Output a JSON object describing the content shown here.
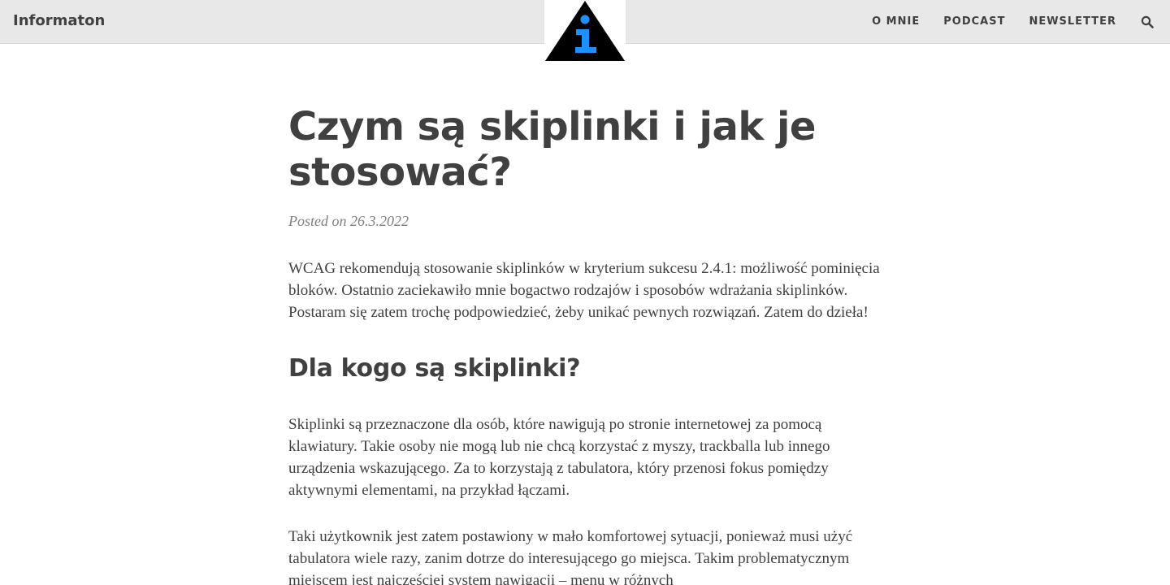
{
  "site": {
    "brand": "Informaton",
    "logo_icon": "info-triangle-icon",
    "colors": {
      "header_bg": "#e8e8e8",
      "logo_triangle": "#000000",
      "logo_info": "#1e90ff",
      "text": "#404040",
      "meta": "#808080"
    }
  },
  "nav": {
    "items": [
      {
        "label": "O MNIE"
      },
      {
        "label": "PODCAST"
      },
      {
        "label": "NEWSLETTER"
      }
    ],
    "search_icon": "search-icon"
  },
  "article": {
    "title": "Czym są skiplinki i jak je stosować?",
    "meta": "Posted on 26.3.2022",
    "intro": "WCAG rekomendują stosowanie skiplinków w kryterium sukcesu 2.4.1: możliwość pominięcia bloków. Ostatnio zaciekawiło mnie bogactwo rodzajów i sposobów wdrażania skiplinków. Postaram się zatem trochę podpowiedzieć, żeby unikać pewnych rozwiązań. Zatem do dzieła!",
    "section_heading": "Dla kogo są skiplinki?",
    "para1": "Skiplinki są przeznaczone dla osób, które nawigują po stronie internetowej za pomocą klawiatury. Takie osoby nie mogą lub nie chcą korzystać z myszy, trackballa lub innego urządzenia wskazującego. Za to korzystają z tabulatora, który przenosi fokus pomiędzy aktywnymi elementami, na przykład łączami.",
    "para2": "Taki użytkownik jest zatem postawiony w mało komfortowej sytuacji, ponieważ musi użyć tabulatora wiele razy, zanim dotrze do interesującego go miejsca. Takim problematycznym miejscem jest najczęściej system nawigacji – menu w różnych"
  }
}
